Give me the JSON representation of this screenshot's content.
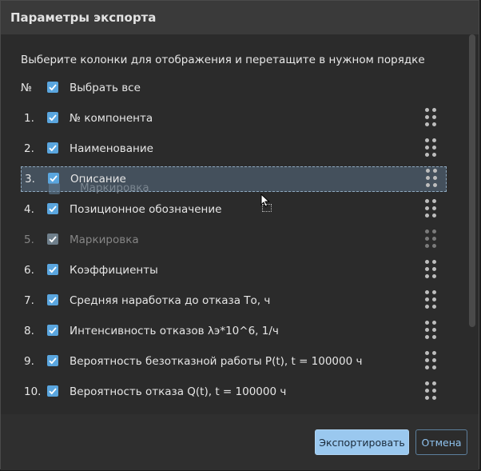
{
  "dialog": {
    "title": "Параметры экспорта",
    "instructions": "Выберите колонки для отображения и перетащите в нужном порядке"
  },
  "header": {
    "num_label": "№",
    "select_all_label": "Выбрать все",
    "select_all_checked": true
  },
  "columns": [
    {
      "num": "1.",
      "label": "№ компонента",
      "checked": true,
      "state": "normal"
    },
    {
      "num": "2.",
      "label": "Наименование",
      "checked": true,
      "state": "normal"
    },
    {
      "num": "3.",
      "label": "Описание",
      "checked": true,
      "state": "dragging"
    },
    {
      "num": "4.",
      "label": "Позиционное обозначение",
      "checked": true,
      "state": "normal"
    },
    {
      "num": "5.",
      "label": "Маркировка",
      "checked": true,
      "state": "disabled"
    },
    {
      "num": "6.",
      "label": "Коэффициенты",
      "checked": true,
      "state": "normal"
    },
    {
      "num": "7.",
      "label": "Средняя наработка до отказа То, ч",
      "checked": true,
      "state": "normal"
    },
    {
      "num": "8.",
      "label": "Интенсивность отказов λэ*10^6, 1/ч",
      "checked": true,
      "state": "normal"
    },
    {
      "num": "9.",
      "label": "Вероятность безотказной работы P(t), t = 100000 ч",
      "checked": true,
      "state": "normal"
    },
    {
      "num": "10.",
      "label": "Вероятность отказа Q(t), t = 100000 ч",
      "checked": true,
      "state": "normal"
    }
  ],
  "drag_ghost": {
    "label": "Маркировка"
  },
  "footer": {
    "export_label": "Экспортировать",
    "cancel_label": "Отмена"
  },
  "colors": {
    "accent": "#5aa6df",
    "primary_button": "#9ac8ef",
    "dialog_bg": "#2b2b2b",
    "title_bg": "#3a3a3a"
  }
}
